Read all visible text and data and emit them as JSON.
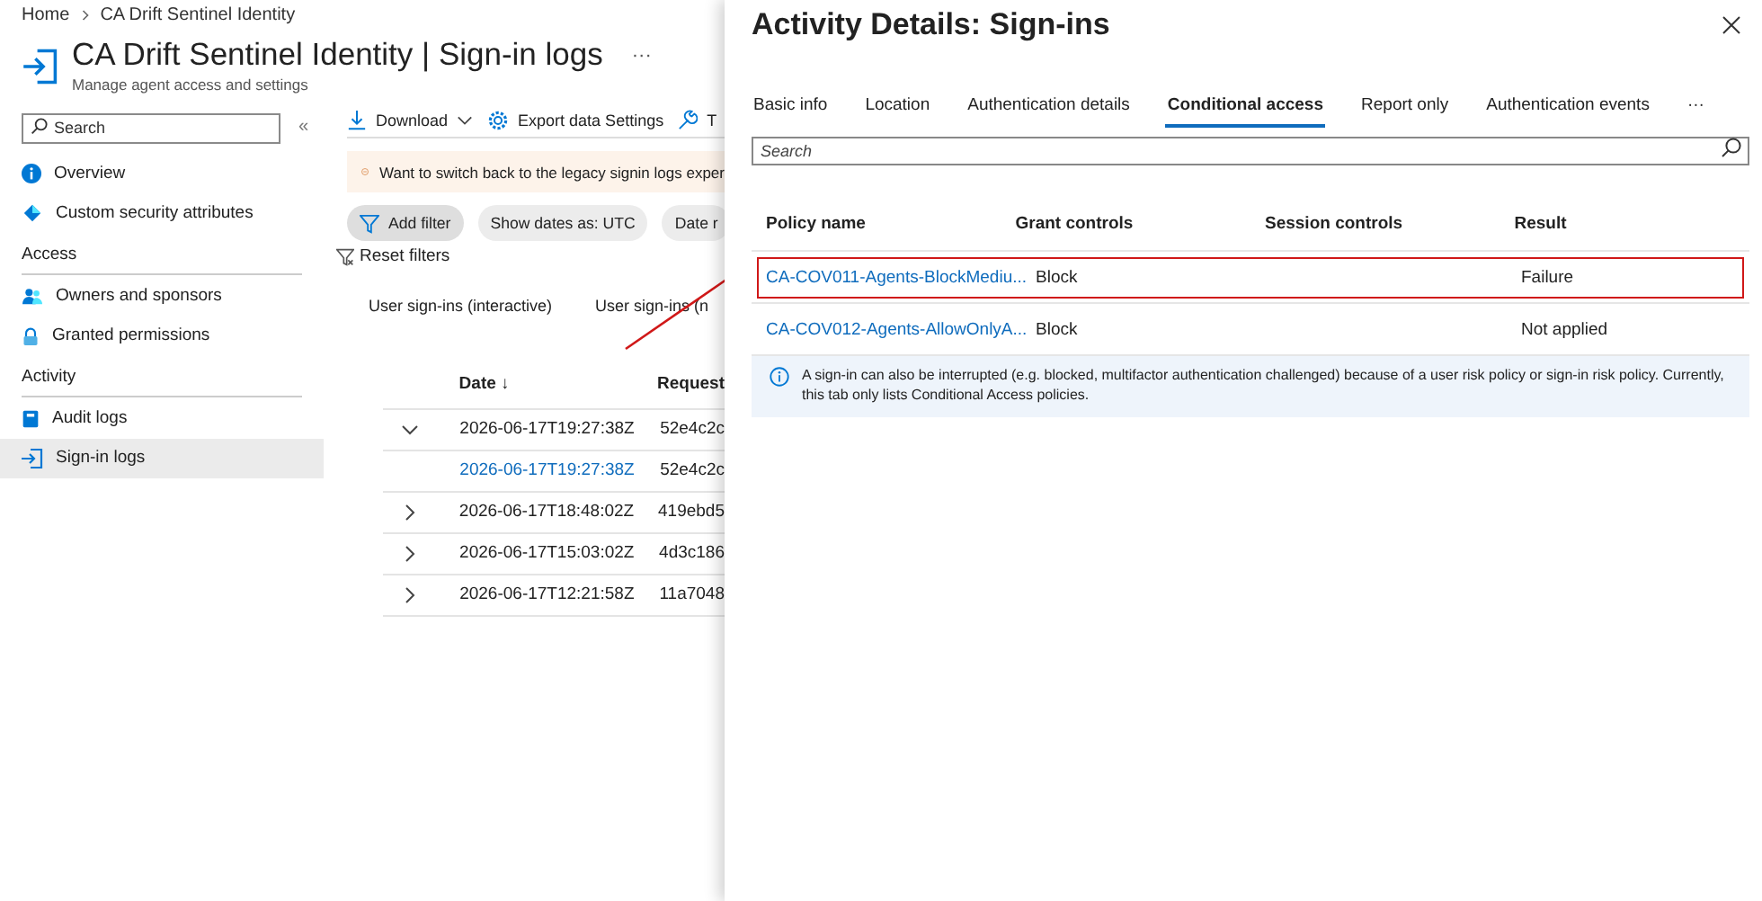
{
  "breadcrumb": [
    "Home",
    "CA Drift Sentinel Identity"
  ],
  "header": {
    "title": "CA Drift Sentinel Identity | Sign-in logs",
    "more": "···",
    "subtitle": "Manage agent access and settings"
  },
  "sidebar": {
    "search": {
      "placeholder": "Search"
    },
    "collapse": "«",
    "items": [
      {
        "kind": "item",
        "label": "Overview",
        "selected": false
      },
      {
        "kind": "item",
        "label": "Custom security attributes",
        "selected": false
      },
      {
        "kind": "heading",
        "label": "Access"
      },
      {
        "kind": "item",
        "label": "Owners and sponsors",
        "selected": false
      },
      {
        "kind": "item",
        "label": "Granted permissions",
        "selected": false
      },
      {
        "kind": "heading",
        "label": "Activity"
      },
      {
        "kind": "item",
        "label": "Audit logs",
        "selected": false
      },
      {
        "kind": "item",
        "label": "Sign-in logs",
        "selected": true
      }
    ]
  },
  "toolbar": [
    "Download",
    "Export data Settings",
    "T"
  ],
  "banner": "Want to switch back to the legacy signin logs exper",
  "filters": [
    "Add filter",
    "Show dates as: UTC",
    "Date r"
  ],
  "reset_filters": "Reset filters",
  "log_tabs": [
    "User sign-ins (interactive)",
    "User sign-ins (n"
  ],
  "table": {
    "columns": [
      "Date ↓",
      "Request"
    ],
    "rows": [
      {
        "date": "2026-06-17T19:27:38Z",
        "request": "52e4c2c",
        "expanded": true,
        "children": [
          {
            "date": "2026-06-17T19:27:38Z",
            "request": "52e4c2c"
          }
        ]
      },
      {
        "date": "2026-06-17T18:48:02Z",
        "request": "419ebd5",
        "expanded": false
      },
      {
        "date": "2026-06-17T15:03:02Z",
        "request": "4d3c186",
        "expanded": false
      },
      {
        "date": "2026-06-17T12:21:58Z",
        "request": "11a7048",
        "expanded": false
      }
    ]
  },
  "panel": {
    "title": "Activity Details: Sign-ins",
    "tabs": [
      {
        "label": "Basic info",
        "selected": false
      },
      {
        "label": "Location",
        "selected": false
      },
      {
        "label": "Authentication details",
        "selected": false
      },
      {
        "label": "Conditional access",
        "selected": true
      },
      {
        "label": "Report only",
        "selected": false
      },
      {
        "label": "Authentication events",
        "selected": false
      }
    ],
    "tabs_more": "···",
    "search": {
      "placeholder": "Search"
    },
    "columns": [
      "Policy name",
      "Grant controls",
      "Session controls",
      "Result"
    ],
    "rows": [
      {
        "policy": "CA-COV011-Agents-BlockMediu...",
        "grant": "Block",
        "result": "Failure",
        "highlighted": true
      },
      {
        "policy": "CA-COV012-Agents-AllowOnlyA...",
        "grant": "Block",
        "result": "Not applied",
        "highlighted": false
      }
    ],
    "info": "A sign-in can also be interrupted (e.g. blocked, multifactor authentication challenged) because of a user risk policy or sign-in risk policy. Currently, this tab only lists Conditional Access policies."
  }
}
